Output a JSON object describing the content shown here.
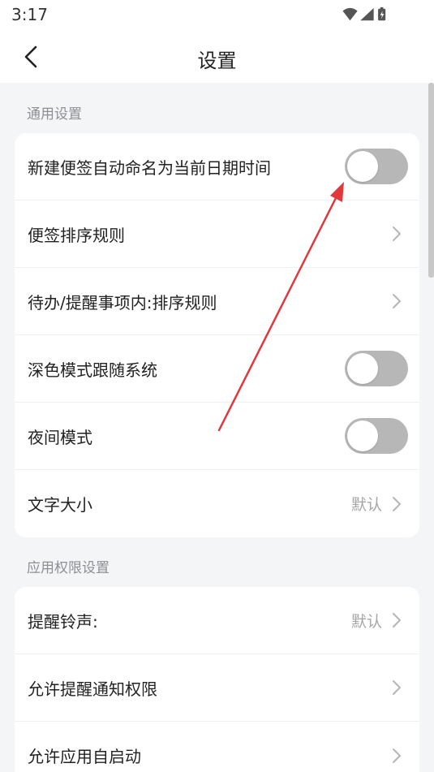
{
  "status_bar": {
    "time": "3:17",
    "icons": [
      "wifi-icon",
      "signal-icon",
      "battery-icon"
    ]
  },
  "header": {
    "title": "设置",
    "back_icon": "chevron-left-icon"
  },
  "sections": [
    {
      "title": "通用设置",
      "items": [
        {
          "label": "新建便签自动命名为当前日期时间",
          "control": "toggle",
          "on": false
        },
        {
          "label": "便签排序规则",
          "control": "chevron"
        },
        {
          "label": "待办/提醒事项内:排序规则",
          "control": "chevron"
        },
        {
          "label": "深色模式跟随系统",
          "control": "toggle",
          "on": false
        },
        {
          "label": "夜间模式",
          "control": "toggle",
          "on": false
        },
        {
          "label": "文字大小",
          "value": "默认",
          "control": "chevron"
        }
      ]
    },
    {
      "title": "应用权限设置",
      "items": [
        {
          "label": "提醒铃声:",
          "value": "默认",
          "control": "chevron"
        },
        {
          "label": "允许提醒通知权限",
          "control": "chevron"
        },
        {
          "label": "允许应用自启动",
          "control": "chevron"
        }
      ]
    }
  ],
  "colors": {
    "background": "#f4f5f7",
    "card": "#ffffff",
    "toggle_off": "#b7b7b7",
    "annotation_arrow": "#e0383c",
    "section_title": "#8e8e93"
  }
}
